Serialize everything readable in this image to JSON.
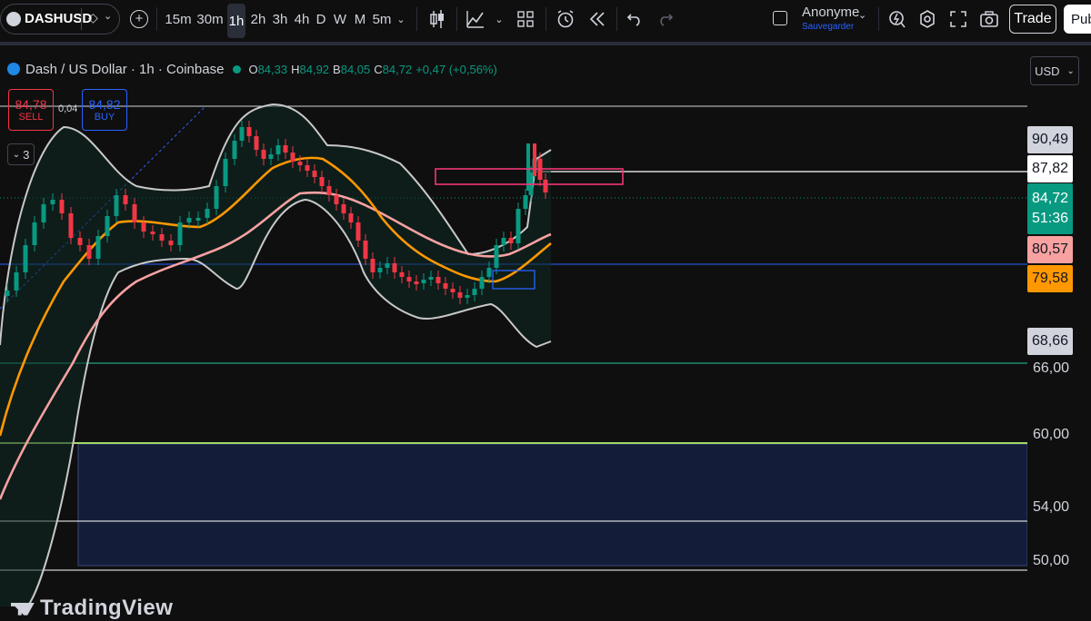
{
  "toolbar": {
    "symbol": "DASHUSD",
    "timeframes": [
      "15m",
      "30m",
      "1h",
      "2h",
      "3h",
      "4h",
      "D",
      "W",
      "M",
      "5m"
    ],
    "active_timeframe": "1h",
    "account_name": "Anonyme",
    "account_sub": "Sauvegarder",
    "trade_label": "Trade",
    "publish_label": "Pub"
  },
  "legend": {
    "title": "Dash / US Dollar · 1h · Coinbase",
    "o_label": "O",
    "o_value": "84,33",
    "h_label": "H",
    "h_value": "84,92",
    "b_label": "B",
    "b_value": "84,05",
    "c_label": "C",
    "c_value": "84,72",
    "change": "+0,47 (+0,56%)",
    "indicator_count": "3"
  },
  "order_panel": {
    "sell_price": "84,78",
    "sell_label": "SELL",
    "spread": "0,04",
    "buy_price": "84,82",
    "buy_label": "BUY"
  },
  "price_scale": {
    "currency": "USD",
    "tags": [
      {
        "value": "90,49",
        "bg": "#d1d4dc",
        "fg": "#131722"
      },
      {
        "value": "87,82",
        "bg": "#ffffff",
        "fg": "#131722"
      },
      {
        "value": "84,72",
        "bg": "#089981",
        "fg": "#ffffff",
        "countdown": "51:36"
      },
      {
        "value": "80,57",
        "bg": "#f7a1a1",
        "fg": "#131722"
      },
      {
        "value": "79,58",
        "bg": "#ff9800",
        "fg": "#131722"
      },
      {
        "value": "68,66",
        "bg": "#d1d4dc",
        "fg": "#131722"
      }
    ],
    "labels": [
      "66,00",
      "60,00",
      "54,00",
      "50,00"
    ]
  },
  "colors": {
    "bull": "#089981",
    "bear": "#f23645",
    "ma_fast": "#ff9800",
    "ma_slow": "#f7a1a1",
    "bollinger": "#c8c8c8",
    "zone_fill": "#131d3a"
  },
  "brand": "TradingView"
}
